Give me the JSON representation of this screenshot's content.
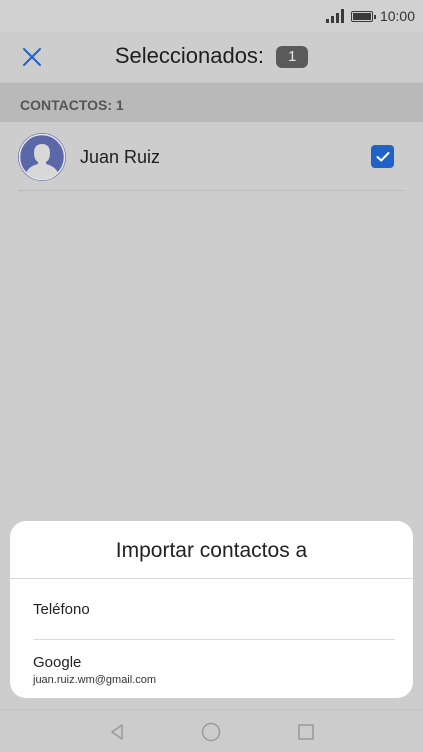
{
  "status_bar": {
    "time": "10:00",
    "signal_icon": "signal-icon",
    "battery_icon": "battery-icon"
  },
  "app_bar": {
    "close_icon": "close-icon",
    "title": "Seleccionados:",
    "selected_count": "1"
  },
  "section": {
    "header": "CONTACTOS: 1"
  },
  "contacts": [
    {
      "name": "Juan Ruiz",
      "checked": true,
      "avatar_icon": "person-avatar-icon"
    }
  ],
  "sheet": {
    "title": "Importar contactos a",
    "options": [
      {
        "label": "Teléfono"
      },
      {
        "label": "Google",
        "sub": "juan.ruiz.wm@gmail.com"
      }
    ]
  },
  "nav_bar": {
    "back_icon": "back-triangle-icon",
    "home_icon": "home-circle-icon",
    "recents_icon": "recents-square-icon"
  },
  "colors": {
    "accent": "#1f63c9",
    "dim_background": "#cdcdcd",
    "sheet_background": "#ffffff"
  }
}
